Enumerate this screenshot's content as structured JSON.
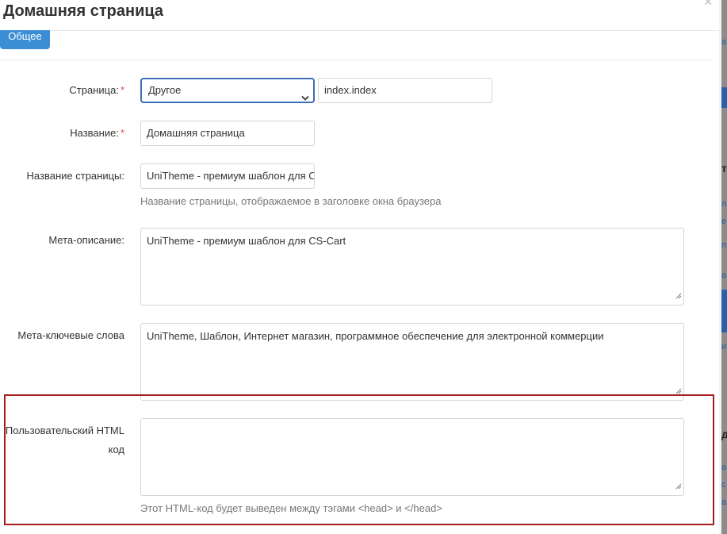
{
  "modal": {
    "title": "Домашняя страница",
    "close": "×"
  },
  "tabs": {
    "general": "Общее"
  },
  "form": {
    "page": {
      "label": "Страница:",
      "required": "*",
      "selected": "Другое",
      "dispatch": "index.index"
    },
    "name": {
      "label": "Название:",
      "required": "*",
      "value": "Домашняя страница"
    },
    "page_title": {
      "label": "Название страницы:",
      "value": "UniTheme - премиум шаблон для CS-Cart",
      "hint": "Название страницы, отображаемое в заголовке окна браузера"
    },
    "meta_description": {
      "label": "Мета-описание:",
      "value": "UniTheme - премиум шаблон для CS-Cart"
    },
    "meta_keywords": {
      "label": "Мета-ключевые слова",
      "value": "UniTheme, Шаблон, Интернет магазин, программное обеспечение для электронной коммерции"
    },
    "custom_html": {
      "label_line1": "Пользовательский HTML",
      "label_line2": "код",
      "value": "",
      "hint": "Этот HTML-код будет выведен между тэгами <head> и </head>"
    }
  },
  "background_fragments": [
    "а",
    "т",
    "л",
    "е",
    "п",
    "а",
    "и",
    "д",
    "а",
    "с",
    "а"
  ],
  "colors": {
    "accent": "#3c8ed4",
    "select_border": "#3b6fb6",
    "required": "#d9534f",
    "highlight": "#a61c1c"
  }
}
